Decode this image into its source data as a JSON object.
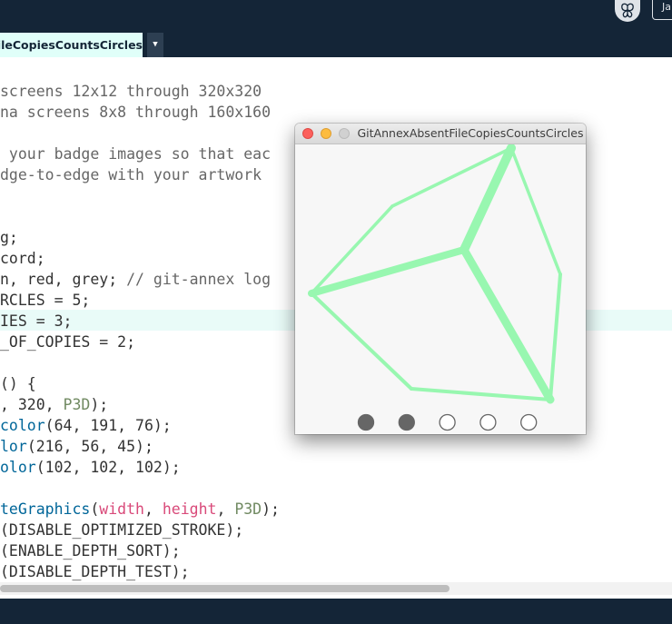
{
  "topbar": {
    "mode_label": "Ja",
    "mode_icon": "butterfly-icon"
  },
  "tab": {
    "name": "GitAnnexAbsentFileCopiesCountsCircles",
    "menu_icon": "dropdown-arrow-icon",
    "menu_glyph": "▼"
  },
  "sketch_window": {
    "title": "GitAnnexAbsentFileCopiesCountsCircles",
    "colors": {
      "stroke": "#98f7b0",
      "filled_circle": "#666666",
      "empty_circle": "#666666",
      "background": "#f7f7f7"
    },
    "circles": {
      "total": 5,
      "filled": 2
    }
  }
}
